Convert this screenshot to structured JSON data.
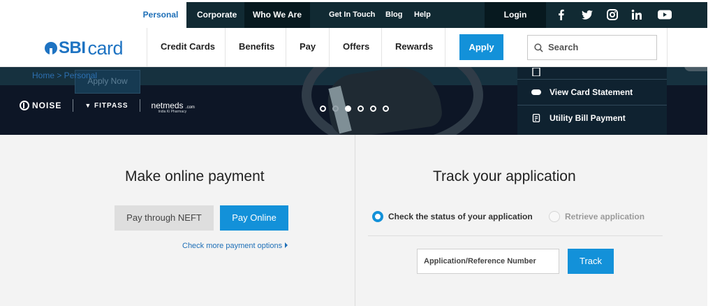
{
  "topnav": {
    "items": [
      "Personal",
      "Corporate",
      "Who We Are",
      "Get In Touch",
      "Blog",
      "Help",
      "Login"
    ],
    "social_icons": [
      "facebook-icon",
      "twitter-icon",
      "instagram-icon",
      "linkedin-icon",
      "youtube-icon"
    ]
  },
  "brand": {
    "logo_sbi": "SBI",
    "logo_card": "card"
  },
  "mainnav": {
    "items": [
      "Credit Cards",
      "Benefits",
      "Pay",
      "Offers",
      "Rewards"
    ],
    "apply_label": "Apply",
    "search_placeholder": "Search"
  },
  "hero": {
    "breadcrumb": "Home > Personal",
    "apply_now_label": "Apply Now",
    "partners": [
      "NOISE",
      "FITPASS",
      "netmeds",
      ".com",
      "India Ki Pharmacy"
    ],
    "carousel": {
      "total": 6,
      "active": 3
    }
  },
  "quick_links": {
    "items": [
      {
        "label": "View Card Statement",
        "icon": "card-icon"
      },
      {
        "label": "Utility Bill Payment",
        "icon": "bill-icon"
      }
    ]
  },
  "payment": {
    "title": "Make online payment",
    "neft_label": "Pay through NEFT",
    "online_label": "Pay Online",
    "more_link": "Check more payment options"
  },
  "track": {
    "title": "Track your application",
    "option_status": "Check the status of your application",
    "option_retrieve": "Retrieve application",
    "input_placeholder": "Application/Reference Number",
    "track_label": "Track"
  },
  "colors": {
    "accent": "#1391d9",
    "topbar": "#112a33",
    "link": "#1e6fb7"
  }
}
